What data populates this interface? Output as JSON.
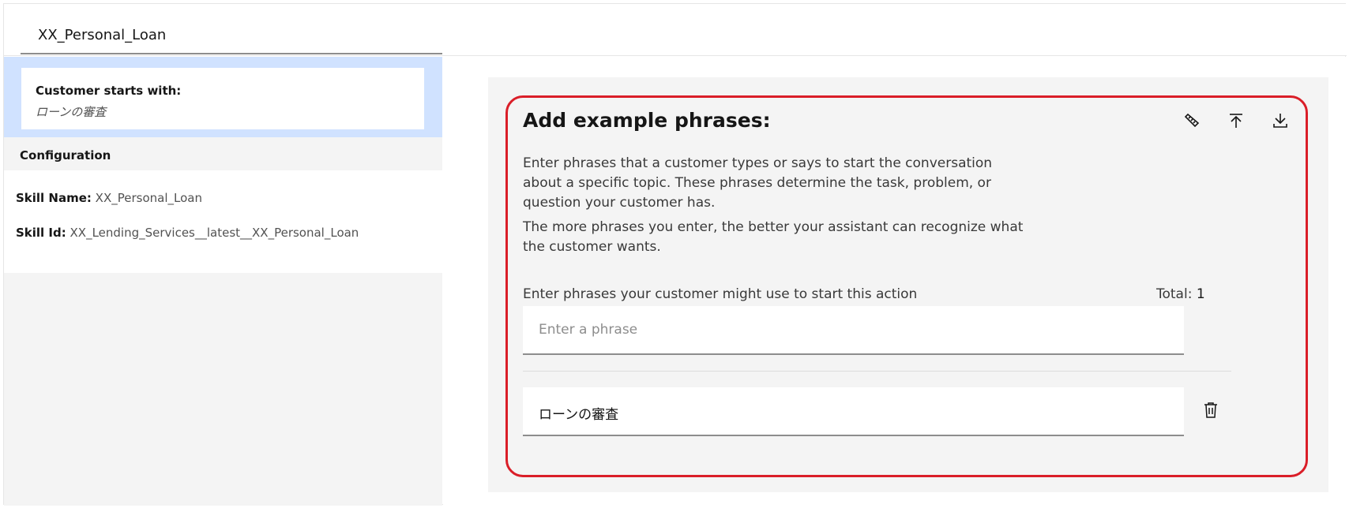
{
  "header": {
    "action_name": "XX_Personal_Loan"
  },
  "sidebar": {
    "starts_with_label": "Customer starts with:",
    "starts_with_value": "ローンの審査",
    "configuration_label": "Configuration",
    "skill_name_key": "Skill Name:",
    "skill_name_value": " XX_Personal_Loan",
    "skill_id_key": "Skill Id:",
    "skill_id_value": " XX_Lending_Services__latest__XX_Personal_Loan"
  },
  "editor": {
    "title": "Add example phrases:",
    "description_1": "Enter phrases that a customer types or says to start the conversation about a specific topic. These phrases determine the task, problem, or question your customer has.",
    "description_2": "The more phrases you enter, the better your assistant can recognize what the customer wants.",
    "phrases_label": "Enter phrases your customer might use to start this action",
    "total_label": "Total: ",
    "total_count": "1",
    "input_placeholder": "Enter a phrase",
    "phrases": [
      "ローンの審査"
    ],
    "toolbar_icons": [
      "recommend-icon",
      "upload-icon",
      "download-icon"
    ],
    "highlight_color": "#da1e28"
  }
}
